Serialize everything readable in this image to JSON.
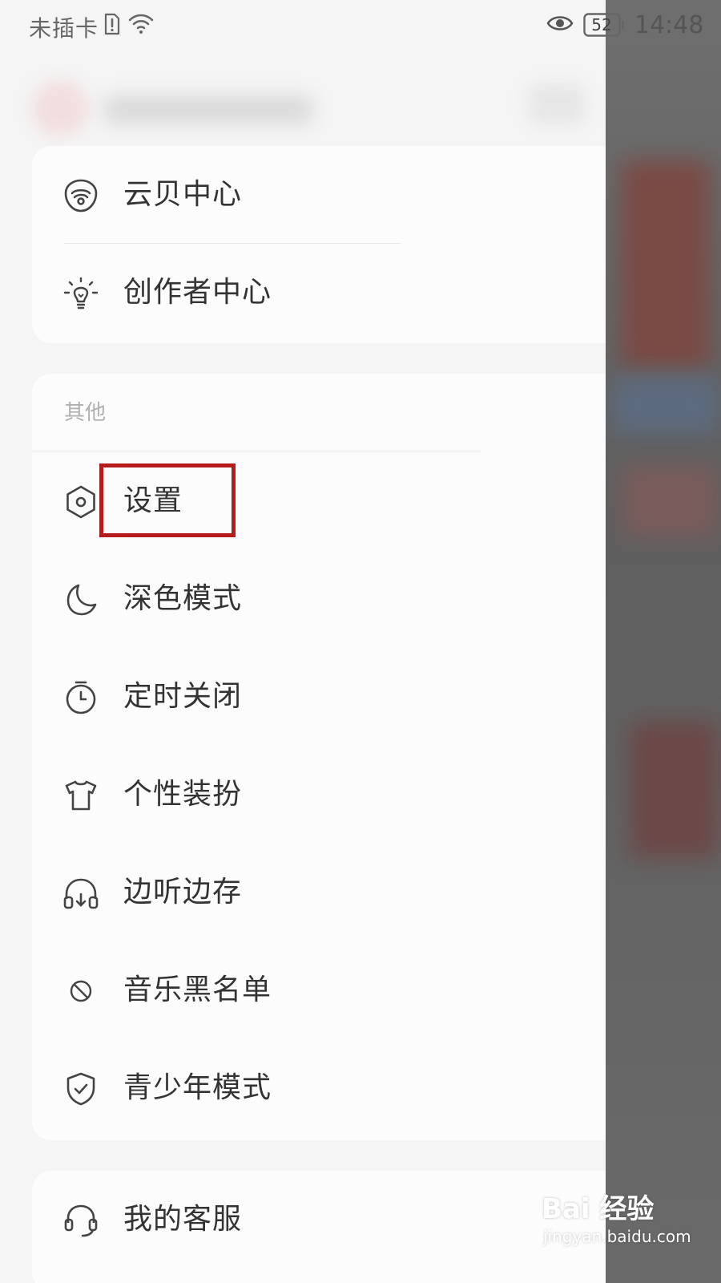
{
  "status_bar": {
    "carrier": "未插卡",
    "battery": "52",
    "time": "14:48",
    "icons": [
      "sim-alert-icon",
      "wifi-icon",
      "eye-icon",
      "battery-icon"
    ]
  },
  "menu_top": [
    {
      "label": "云贝中心",
      "icon": "yunbei-icon"
    },
    {
      "label": "创作者中心",
      "icon": "lightbulb-icon"
    }
  ],
  "section_other": {
    "title": "其他",
    "items": [
      {
        "label": "设置",
        "icon": "settings-hexagon-icon"
      },
      {
        "label": "深色模式",
        "icon": "moon-icon"
      },
      {
        "label": "定时关闭",
        "icon": "timer-icon"
      },
      {
        "label": "个性装扮",
        "icon": "tshirt-icon"
      },
      {
        "label": "边听边存",
        "icon": "headphone-download-icon"
      },
      {
        "label": "音乐黑名单",
        "icon": "block-icon"
      },
      {
        "label": "青少年模式",
        "icon": "shield-check-icon"
      }
    ]
  },
  "menu_service": [
    {
      "label": "我的客服",
      "icon": "headset-icon"
    }
  ],
  "watermark": {
    "brand": "Bai 经验",
    "url": "jingyan.baidu.com"
  },
  "colors": {
    "highlight": "#b71c1c",
    "drawer_bg": "#f5f5f5",
    "card_bg": "#fcfcfc",
    "overlay": "#6a6a6a"
  }
}
